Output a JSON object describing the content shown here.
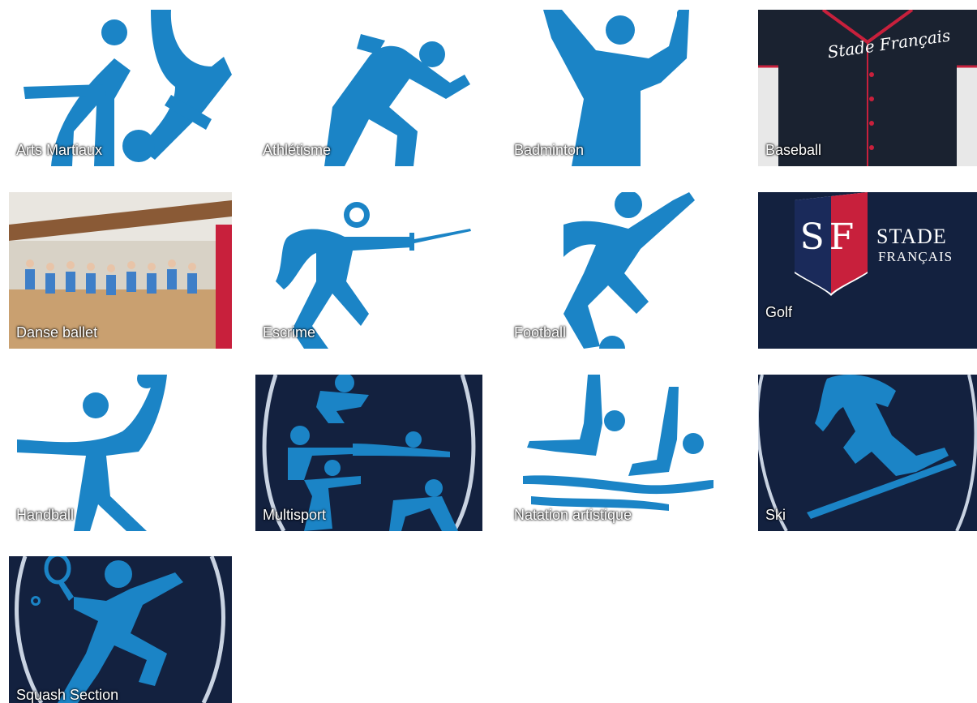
{
  "sections": [
    {
      "label": "Arts Martiaux",
      "icon": "martial-arts-icon"
    },
    {
      "label": "Athlétisme",
      "icon": "runner-icon"
    },
    {
      "label": "Badminton",
      "icon": "badminton-player-icon"
    },
    {
      "label": "Baseball",
      "icon": "baseball-jersey-image",
      "jersey_text": "Stade Français"
    },
    {
      "label": "Danse ballet",
      "icon": "ballet-class-photo"
    },
    {
      "label": "Escrime",
      "icon": "fencer-icon"
    },
    {
      "label": "Football",
      "icon": "footballer-icon"
    },
    {
      "label": "Golf",
      "icon": "stade-francais-logo",
      "logo_monogram": "SF",
      "logo_line1": "STADE",
      "logo_line2": "FRANÇAIS"
    },
    {
      "label": "Handball",
      "icon": "handball-player-icon"
    },
    {
      "label": "Multisport",
      "icon": "multisport-icon"
    },
    {
      "label": "Natation artistique",
      "icon": "artistic-swimming-icon"
    },
    {
      "label": "Ski",
      "icon": "skier-icon"
    },
    {
      "label": "Squash Section",
      "icon": "squash-player-icon"
    }
  ],
  "colors": {
    "icon_blue": "#1b84c6",
    "navy": "#13213f",
    "red": "#c8203c",
    "white": "#ffffff"
  }
}
